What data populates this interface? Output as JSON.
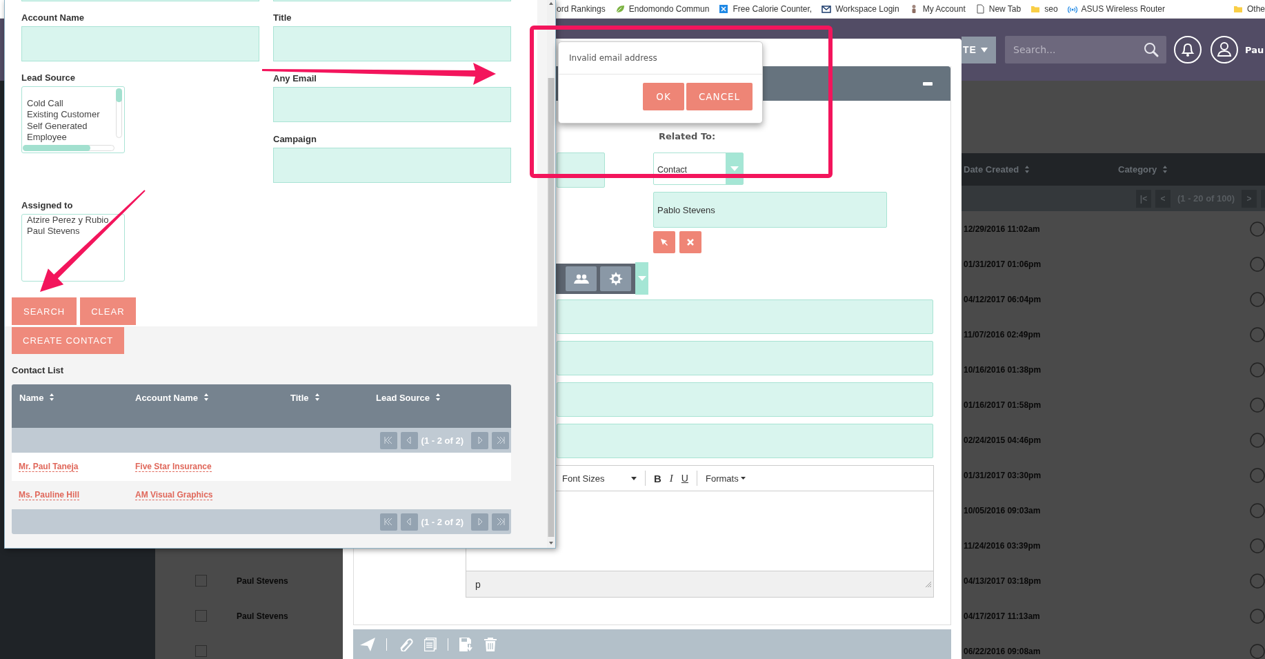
{
  "bookmarks": [
    {
      "label": "ord Rankings",
      "kind": "none"
    },
    {
      "label": "Endomondo Commun",
      "kind": "leaf"
    },
    {
      "label": "Free Calorie Counter,",
      "kind": "tile"
    },
    {
      "label": "Workspace Login",
      "kind": "mail"
    },
    {
      "label": "My Account",
      "kind": "figure"
    },
    {
      "label": "New Tab",
      "kind": "page"
    },
    {
      "label": "seo",
      "kind": "folder"
    },
    {
      "label": "ASUS Wireless Router",
      "kind": "signal"
    },
    {
      "label": "Othe",
      "kind": "folder"
    }
  ],
  "contact_search": {
    "left_fields": [
      {
        "kind": "input",
        "label": "Account Name"
      },
      {
        "kind": "list",
        "label": "Lead Source",
        "options": [
          "Cold Call",
          "Existing Customer",
          "Self Generated",
          "Employee"
        ],
        "scrollable": true
      },
      {
        "kind": "list",
        "label": "Assigned to",
        "options": [
          "Atzire Perez y Rubio",
          "Paul Stevens"
        ],
        "scrollable": false
      }
    ],
    "right_fields": [
      {
        "kind": "input",
        "label": "Title"
      },
      {
        "kind": "input",
        "label": "Any Email"
      },
      {
        "kind": "input",
        "label": "Campaign"
      }
    ],
    "buttons": [
      "SEARCH",
      "CLEAR"
    ],
    "create_button": "CREATE CONTACT",
    "list_title": "Contact List",
    "table": {
      "columns": [
        "Name",
        "Account Name",
        "Title",
        "Lead Source"
      ],
      "pager_top": "(1 - 2 of 2)",
      "rows": [
        {
          "name": "Mr. Paul Taneja",
          "account": "Five Star Insurance"
        },
        {
          "name": "Ms. Pauline Hill",
          "account": "AM Visual Graphics"
        }
      ],
      "pager_bottom": "(1 - 2 of 2)"
    }
  },
  "top_bar": {
    "create_button": "TE",
    "search": {
      "placeholder": "Search..."
    },
    "user_name": "Pau"
  },
  "alert": {
    "message": "Invalid email address",
    "buttons": [
      "OK",
      "CANCEL"
    ]
  },
  "email_modal": {
    "related_label": "Related To:",
    "related_type": "Contact",
    "related_name": "Pablo Stevens",
    "editor": {
      "font_sizes": "Font Sizes",
      "bold": "B",
      "italic": "I",
      "underline": "U",
      "formats": "Formats",
      "status": "p"
    }
  },
  "records": {
    "columns": [
      "Date Created",
      "Category"
    ],
    "pager": {
      "first": "|<",
      "prev": "<",
      "range": "(1 - 20 of 100)",
      "next": ">"
    },
    "rows": [
      {
        "date_created": "12/29/2016 11:02am"
      },
      {
        "date_created": "01/31/2017 01:06pm"
      },
      {
        "date_created": "04/12/2017 06:04pm"
      },
      {
        "date_created": "11/07/2016 02:49pm"
      },
      {
        "date_created": "10/16/2016 01:38pm"
      },
      {
        "date_created": "01/16/2017 01:58pm"
      },
      {
        "date_created": "02/24/2015 04:46pm"
      },
      {
        "date_created": "01/31/2017 03:30pm"
      },
      {
        "date_created": "10/05/2016 09:03am"
      },
      {
        "date_created": "11/24/2016 03:39pm"
      },
      {
        "assigned": "Paul Stevens",
        "checked": false,
        "date_created": "04/13/2017 03:18pm"
      },
      {
        "assigned": "Paul Stevens",
        "checked": false,
        "date_created": "04/17/2017 11:13am"
      },
      {
        "checked": false,
        "date_created": "06/22/2016 09:08am"
      }
    ]
  }
}
